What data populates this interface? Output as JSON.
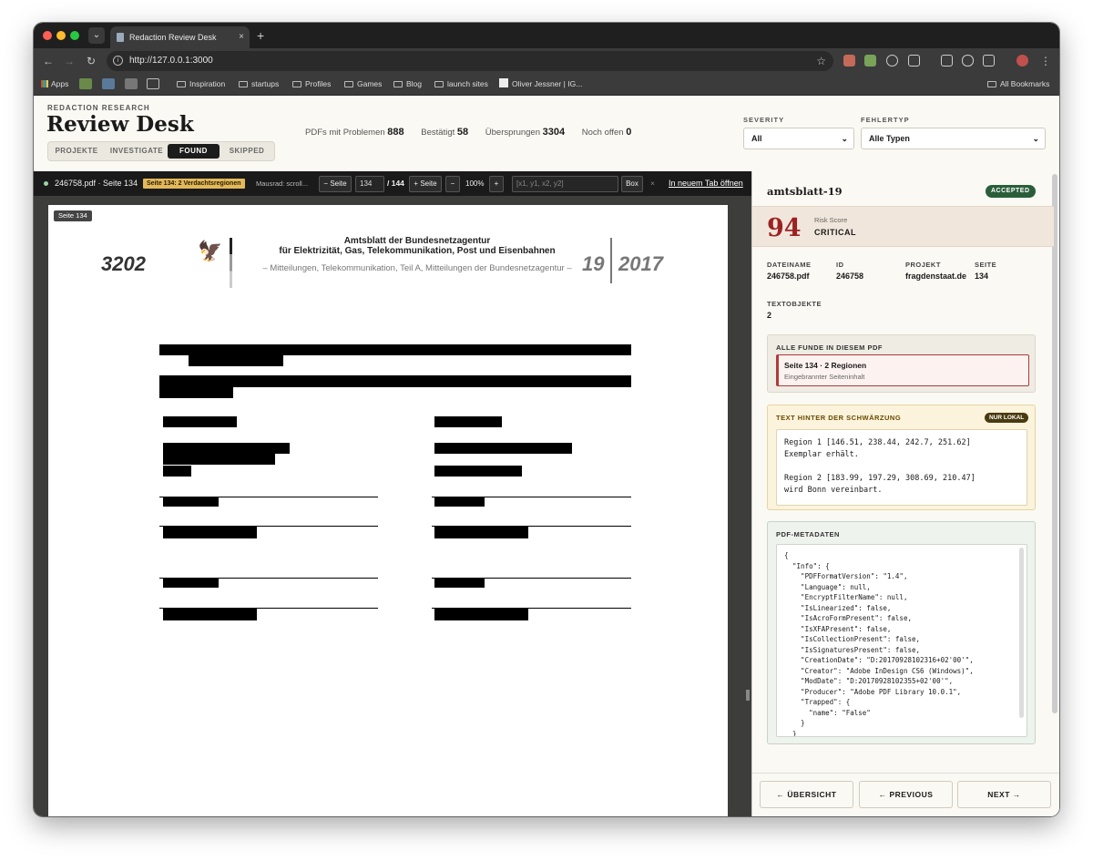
{
  "browser": {
    "tab_title": "Redaction Review Desk",
    "tab_close": "×",
    "new_tab": "+",
    "url": "http://127.0.0.1:3000",
    "bookmarks": {
      "apps": "Apps",
      "items": [
        "Inspiration",
        "startups",
        "Profiles",
        "Games",
        "Blog",
        "launch sites"
      ],
      "profile_link": "Oliver Jessner | IG...",
      "all_bookmarks": "All Bookmarks"
    },
    "icons": {
      "back": "back-arrow-icon",
      "forward": "forward-arrow-icon",
      "reload": "reload-icon",
      "star": "bookmark-star-icon",
      "menu": "kebab-menu-icon"
    }
  },
  "header": {
    "kicker": "REDACTION RESEARCH",
    "title": "Review Desk",
    "tabs": [
      {
        "label": "PROJEKTE",
        "active": false
      },
      {
        "label": "INVESTIGATE",
        "active": false
      },
      {
        "label": "FOUND",
        "active": true
      },
      {
        "label": "SKIPPED",
        "active": false
      }
    ],
    "stats": [
      {
        "label": "PDFs mit Problemen",
        "value": "888"
      },
      {
        "label": "Bestätigt",
        "value": "58"
      },
      {
        "label": "Übersprungen",
        "value": "3304"
      },
      {
        "label": "Noch offen",
        "value": "0"
      }
    ],
    "filters": {
      "severity_label": "SEVERITY",
      "severity_value": "All",
      "type_label": "FEHLERTYP",
      "type_value": "Alle Typen"
    }
  },
  "viewer": {
    "file_label": "246758.pdf · Seite 134",
    "badge": "Seite 134: 2 Verdachtsregionen",
    "hint": "Mausrad: scroll...",
    "prev_page": "− Seite",
    "page_input": "134",
    "page_total": "/ 144",
    "next_page": "+ Seite",
    "zoom_out": "−",
    "zoom": "100%",
    "zoom_in": "+",
    "box_placeholder": "[x1, y1, x2, y2]",
    "box_button": "Box",
    "clear": "×",
    "open_new_tab": "In neuem Tab öffnen"
  },
  "page": {
    "tag": "Seite 134",
    "page_number": "3202",
    "header_line1": "Amtsblatt der Bundesnetzagentur",
    "header_line2": "für Elektrizität, Gas, Telekommunikation, Post und Eisenbahnen",
    "header_line3": "– Mitteilungen, Telekommunikation, Teil A, Mitteilungen der Bundesnetzagentur –",
    "issue": "19",
    "year": "2017"
  },
  "panel": {
    "title": "amtsblatt-19",
    "status": "ACCEPTED",
    "risk_score": "94",
    "risk_label": "Risk Score",
    "risk_level": "CRITICAL",
    "meta": {
      "filename_label": "DATEINAME",
      "filename": "246758.pdf",
      "id_label": "ID",
      "id": "246758",
      "project_label": "PROJEKT",
      "project": "fragdenstaat.de",
      "page_label": "SEITE",
      "page": "134",
      "textobjects_label": "TEXTOBJEKTE",
      "textobjects": "2"
    },
    "findings": {
      "heading": "ALLE FUNDE IN DIESEM PDF",
      "item_title": "Seite 134 · 2 Regionen",
      "item_sub": "Eingebrannter Seiteninhalt"
    },
    "hidden_text": {
      "heading": "TEXT HINTER DER SCHWÄRZUNG",
      "badge": "NUR LOKAL",
      "region1": "Region 1 [146.51, 238.44, 242.7, 251.62]",
      "region1_text": "Exemplar erhält.",
      "region2": "Region 2 [183.99, 197.29, 308.69, 210.47]",
      "region2_text": "wird Bonn vereinbart."
    },
    "pdf_meta": {
      "heading": "PDF-METADATEN",
      "json": "{\n  \"Info\": {\n    \"PDFFormatVersion\": \"1.4\",\n    \"Language\": null,\n    \"EncryptFilterName\": null,\n    \"IsLinearized\": false,\n    \"IsAcroFormPresent\": false,\n    \"IsXFAPresent\": false,\n    \"IsCollectionPresent\": false,\n    \"IsSignaturesPresent\": false,\n    \"CreationDate\": \"D:20170928102316+02'00'\",\n    \"Creator\": \"Adobe InDesign CS6 (Windows)\",\n    \"ModDate\": \"D:20170928102355+02'00'\",\n    \"Producer\": \"Adobe PDF Library 10.0.1\",\n    \"Trapped\": {\n      \"name\": \"False\"\n    }\n  }"
    },
    "nav": {
      "overview": "← ÜBERSICHT",
      "previous": "← PREVIOUS",
      "next": "NEXT →"
    }
  }
}
